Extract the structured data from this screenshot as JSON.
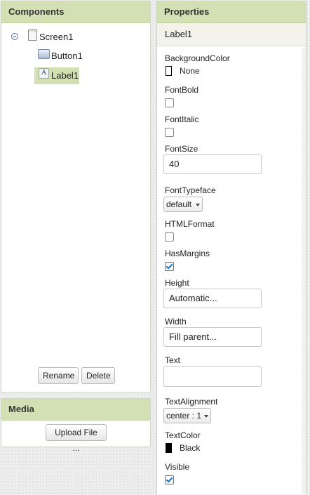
{
  "components": {
    "title": "Components",
    "tree": {
      "screen": "Screen1",
      "children": [
        "Button1",
        "Label1"
      ]
    },
    "selected": "Label1",
    "rename_label": "Rename",
    "delete_label": "Delete"
  },
  "media": {
    "title": "Media",
    "upload_label": "Upload File ..."
  },
  "properties": {
    "title": "Properties",
    "component_name": "Label1",
    "background_color": {
      "label": "BackgroundColor",
      "value": "None",
      "swatch": "#ffffff"
    },
    "font_bold": {
      "label": "FontBold",
      "checked": false
    },
    "font_italic": {
      "label": "FontItalic",
      "checked": false
    },
    "font_size": {
      "label": "FontSize",
      "value": "40"
    },
    "font_typeface": {
      "label": "FontTypeface",
      "value": "default"
    },
    "html_format": {
      "label": "HTMLFormat",
      "checked": false
    },
    "has_margins": {
      "label": "HasMargins",
      "checked": true
    },
    "height": {
      "label": "Height",
      "value": "Automatic..."
    },
    "width": {
      "label": "Width",
      "value": "Fill parent..."
    },
    "text": {
      "label": "Text",
      "value": ""
    },
    "text_alignment": {
      "label": "TextAlignment",
      "value": "center : 1"
    },
    "text_color": {
      "label": "TextColor",
      "value": "Black",
      "swatch": "#000000"
    },
    "visible": {
      "label": "Visible",
      "checked": true
    }
  },
  "colors": {
    "header_bg": "#d2e0b3",
    "selected_bg": "#d2e0b3",
    "check_accent": "#1a6fd0"
  }
}
